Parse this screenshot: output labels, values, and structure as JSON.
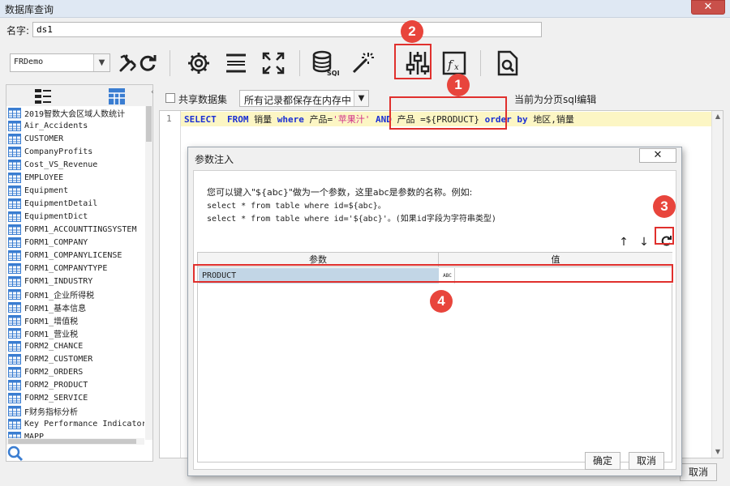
{
  "window": {
    "title": "数据库查询",
    "close": "✕"
  },
  "name_row": {
    "label": "名字:",
    "value": "ds1"
  },
  "toolbar": {
    "db_value": "FRDemo",
    "icons": [
      "wrench-icon",
      "refresh-icon",
      "settings-gear-icon",
      "row-layout-icon",
      "fullscreen-icon",
      "sql-database-icon",
      "magic-wand-icon",
      "parameter-sliders-icon",
      "formula-fx-icon",
      "preview-search-icon"
    ]
  },
  "left_panel": {
    "tables": [
      "2019智数大会区域人数统计",
      "Air_Accidents",
      "CUSTOMER",
      "CompanyProfits",
      "Cost_VS_Revenue",
      "EMPLOYEE",
      "Equipment",
      "EquipmentDetail",
      "EquipmentDict",
      "FORM1_ACCOUNTTINGSYSTEM",
      "FORM1_COMPANY",
      "FORM1_COMPANYLICENSE",
      "FORM1_COMPANYTYPE",
      "FORM1_INDUSTRY",
      "FORM1_企业所得税",
      "FORM1_基本信息",
      "FORM1_增值税",
      "FORM1_营业税",
      "FORM2_CHANCE",
      "FORM2_CUSTOMER",
      "FORM2_ORDERS",
      "FORM2_PRODUCT",
      "FORM2_SERVICE",
      "F财务指标分析",
      "Key Performance Indicator",
      "MAPP"
    ]
  },
  "editor": {
    "share_label": "共享数据集",
    "memory_option": "所有记录都保存在内存中",
    "paging_label": "当前为分页sql编辑",
    "line_number": "1",
    "sql": {
      "t1": "SELECT",
      "t2": "FROM",
      "t3": "销量",
      "t4": "where",
      "t5": "产品=",
      "t6": "'苹果汁'",
      "t7": "AND",
      "t8": "产品 =${PRODUCT}",
      "t9": "order by",
      "t10": "地区,销量"
    }
  },
  "dialog": {
    "title": "参数注入",
    "close": "✕",
    "desc_line1": "您可以键入\"${abc}\"做为一个参数，这里abc是参数的名称。例如:",
    "desc_line2": "select * from table where id=${abc}。",
    "desc_line3": "select * from table where id='${abc}'。(如果id字段为字符串类型)",
    "up": "↑",
    "down": "↓",
    "col_param": "参数",
    "col_value": "值",
    "param_name": "PRODUCT",
    "param_type": "ABC",
    "ok": "确定",
    "cancel": "取消"
  },
  "background_cancel": "取消",
  "annotations": [
    "2",
    "1",
    "3",
    "4"
  ],
  "colors": {
    "annotation_red": "#e8453c",
    "sql_keyword": "#1a2fd4",
    "sql_string": "#d0308a",
    "current_line": "#fcf6c4",
    "selected_row": "#c2d6e6"
  }
}
